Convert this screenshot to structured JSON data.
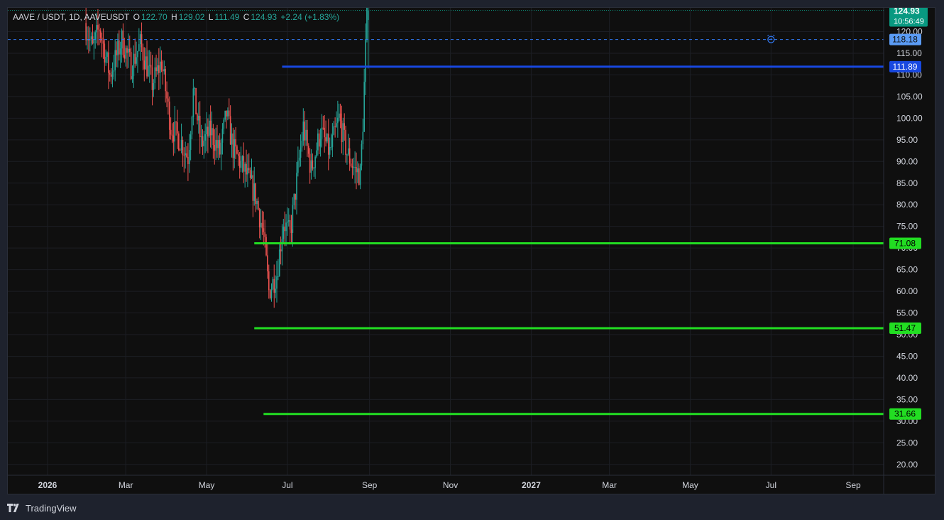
{
  "legend": {
    "symbol": "AAVE / USDT, 1D, AAVEUSDT",
    "open_label": "O",
    "open": "122.70",
    "high_label": "H",
    "high": "129.02",
    "low_label": "L",
    "low": "111.49",
    "close_label": "C",
    "close": "124.93",
    "change": "+2.24 (+1.83%)"
  },
  "price_tag": {
    "price": "124.93",
    "countdown": "10:56:49",
    "color": "#089981"
  },
  "alert_tag": {
    "price": "118.18",
    "color": "#5b9cf6"
  },
  "footer": {
    "brand": "TradingView"
  },
  "colors": {
    "up": "#26a69a",
    "down": "#ef5350",
    "background": "#0f0f0f",
    "grid": "#1c1e24",
    "axis_text": "#d1d4dc"
  },
  "chart_data": {
    "type": "candlestick",
    "y_ticks": [
      "20.00",
      "25.00",
      "30.00",
      "35.00",
      "40.00",
      "45.00",
      "50.00",
      "55.00",
      "60.00",
      "65.00",
      "70.00",
      "75.00",
      "80.00",
      "85.00",
      "90.00",
      "95.00",
      "100.00",
      "105.00",
      "110.00",
      "115.00",
      "120.00"
    ],
    "ylim": [
      17.5,
      125.5
    ],
    "x_ticks": [
      "2026",
      "Mar",
      "May",
      "Jul",
      "Sep",
      "Nov",
      "2027",
      "Mar",
      "May",
      "Jul",
      "Sep"
    ],
    "x_tick_dates": [
      "2026-01-01",
      "2026-03-01",
      "2026-05-01",
      "2026-07-01",
      "2026-09-01",
      "2026-11-01",
      "2027-01-01",
      "2027-03-01",
      "2027-05-01",
      "2027-07-01",
      "2027-09-01"
    ],
    "xlim": [
      "2025-12-02",
      "2027-09-24"
    ],
    "price_path": [
      {
        "date": "2026-01-30",
        "price": 122
      },
      {
        "date": "2026-02-05",
        "price": 116
      },
      {
        "date": "2026-02-10",
        "price": 121
      },
      {
        "date": "2026-02-18",
        "price": 110
      },
      {
        "date": "2026-02-27",
        "price": 118
      },
      {
        "date": "2026-03-06",
        "price": 112
      },
      {
        "date": "2026-03-13",
        "price": 117
      },
      {
        "date": "2026-03-22",
        "price": 108
      },
      {
        "date": "2026-03-29",
        "price": 113
      },
      {
        "date": "2026-04-05",
        "price": 98
      },
      {
        "date": "2026-04-12",
        "price": 95
      },
      {
        "date": "2026-04-18",
        "price": 91
      },
      {
        "date": "2026-04-22",
        "price": 106
      },
      {
        "date": "2026-04-28",
        "price": 94
      },
      {
        "date": "2026-05-05",
        "price": 97
      },
      {
        "date": "2026-05-12",
        "price": 92
      },
      {
        "date": "2026-05-17",
        "price": 101
      },
      {
        "date": "2026-05-22",
        "price": 93
      },
      {
        "date": "2026-06-01",
        "price": 87
      },
      {
        "date": "2026-06-08",
        "price": 82
      },
      {
        "date": "2026-06-14",
        "price": 73
      },
      {
        "date": "2026-06-18",
        "price": 60
      },
      {
        "date": "2026-06-24",
        "price": 64
      },
      {
        "date": "2026-06-29",
        "price": 76
      },
      {
        "date": "2026-07-04",
        "price": 73
      },
      {
        "date": "2026-07-10",
        "price": 88
      },
      {
        "date": "2026-07-14",
        "price": 98
      },
      {
        "date": "2026-07-20",
        "price": 88
      },
      {
        "date": "2026-07-27",
        "price": 97
      },
      {
        "date": "2026-08-03",
        "price": 92
      },
      {
        "date": "2026-08-10",
        "price": 100
      },
      {
        "date": "2026-08-16",
        "price": 92
      },
      {
        "date": "2026-08-22",
        "price": 88
      },
      {
        "date": "2026-08-26",
        "price": 87
      },
      {
        "date": "2026-08-28",
        "price": 99
      },
      {
        "date": "2026-08-31",
        "price": 124.93
      }
    ],
    "last_candle": {
      "open": 122.7,
      "high": 129.02,
      "low": 111.49,
      "close": 124.93
    },
    "horizontal_levels": [
      {
        "price": 111.89,
        "label": "111.89",
        "color": "#1848e0",
        "start": "2026-06-27"
      },
      {
        "price": 71.08,
        "label": "71.08",
        "color": "#22dd22",
        "start": "2026-06-06"
      },
      {
        "price": 51.47,
        "label": "51.47",
        "color": "#22dd22",
        "start": "2026-06-06"
      },
      {
        "price": 31.66,
        "label": "31.66",
        "color": "#22dd22",
        "start": "2026-06-13"
      }
    ],
    "alert_line": {
      "price": 118.18,
      "color": "#3179f5",
      "alert_date": "2027-07-01"
    }
  }
}
